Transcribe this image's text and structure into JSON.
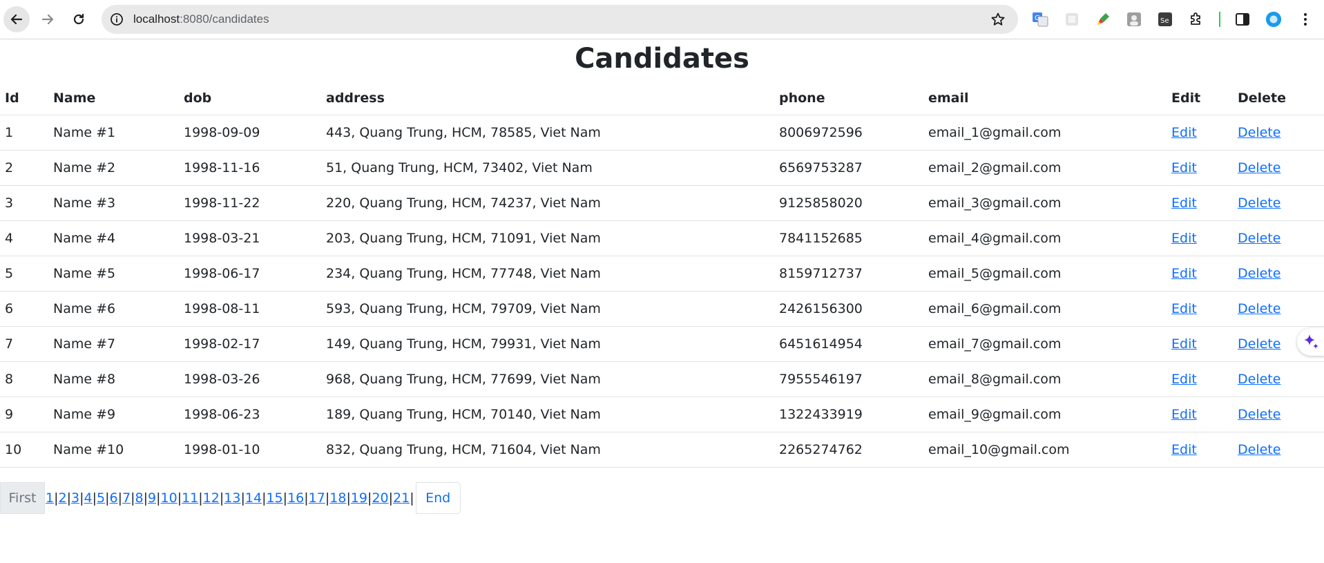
{
  "browser": {
    "url_host": "localhost",
    "url_path": ":8080/candidates"
  },
  "page": {
    "title": "Candidates"
  },
  "table": {
    "headers": {
      "id": "Id",
      "name": "Name",
      "dob": "dob",
      "address": "address",
      "phone": "phone",
      "email": "email",
      "edit": "Edit",
      "delete": "Delete"
    },
    "rows": [
      {
        "id": "1",
        "name": "Name #1",
        "dob": "1998-09-09",
        "address": "443, Quang Trung, HCM, 78585, Viet Nam",
        "phone": "8006972596",
        "email": "email_1@gmail.com",
        "edit": "Edit",
        "delete": "Delete"
      },
      {
        "id": "2",
        "name": "Name #2",
        "dob": "1998-11-16",
        "address": "51, Quang Trung, HCM, 73402, Viet Nam",
        "phone": "6569753287",
        "email": "email_2@gmail.com",
        "edit": "Edit",
        "delete": "Delete"
      },
      {
        "id": "3",
        "name": "Name #3",
        "dob": "1998-11-22",
        "address": "220, Quang Trung, HCM, 74237, Viet Nam",
        "phone": "9125858020",
        "email": "email_3@gmail.com",
        "edit": "Edit",
        "delete": "Delete"
      },
      {
        "id": "4",
        "name": "Name #4",
        "dob": "1998-03-21",
        "address": "203, Quang Trung, HCM, 71091, Viet Nam",
        "phone": "7841152685",
        "email": "email_4@gmail.com",
        "edit": "Edit",
        "delete": "Delete"
      },
      {
        "id": "5",
        "name": "Name #5",
        "dob": "1998-06-17",
        "address": "234, Quang Trung, HCM, 77748, Viet Nam",
        "phone": "8159712737",
        "email": "email_5@gmail.com",
        "edit": "Edit",
        "delete": "Delete"
      },
      {
        "id": "6",
        "name": "Name #6",
        "dob": "1998-08-11",
        "address": "593, Quang Trung, HCM, 79709, Viet Nam",
        "phone": "2426156300",
        "email": "email_6@gmail.com",
        "edit": "Edit",
        "delete": "Delete"
      },
      {
        "id": "7",
        "name": "Name #7",
        "dob": "1998-02-17",
        "address": "149, Quang Trung, HCM, 79931, Viet Nam",
        "phone": "6451614954",
        "email": "email_7@gmail.com",
        "edit": "Edit",
        "delete": "Delete"
      },
      {
        "id": "8",
        "name": "Name #8",
        "dob": "1998-03-26",
        "address": "968, Quang Trung, HCM, 77699, Viet Nam",
        "phone": "7955546197",
        "email": "email_8@gmail.com",
        "edit": "Edit",
        "delete": "Delete"
      },
      {
        "id": "9",
        "name": "Name #9",
        "dob": "1998-06-23",
        "address": "189, Quang Trung, HCM, 70140, Viet Nam",
        "phone": "1322433919",
        "email": "email_9@gmail.com",
        "edit": "Edit",
        "delete": "Delete"
      },
      {
        "id": "10",
        "name": "Name #10",
        "dob": "1998-01-10",
        "address": "832, Quang Trung, HCM, 71604, Viet Nam",
        "phone": "2265274762",
        "email": "email_10@gmail.com",
        "edit": "Edit",
        "delete": "Delete"
      }
    ]
  },
  "pagination": {
    "first_label": "First",
    "end_label": "End",
    "pages": [
      "1",
      "2",
      "3",
      "4",
      "5",
      "6",
      "7",
      "8",
      "9",
      "10",
      "11",
      "12",
      "13",
      "14",
      "15",
      "16",
      "17",
      "18",
      "19",
      "20",
      "21"
    ]
  },
  "colors": {
    "link": "#0d6efd",
    "border": "#dee2e6",
    "text": "#212529"
  }
}
